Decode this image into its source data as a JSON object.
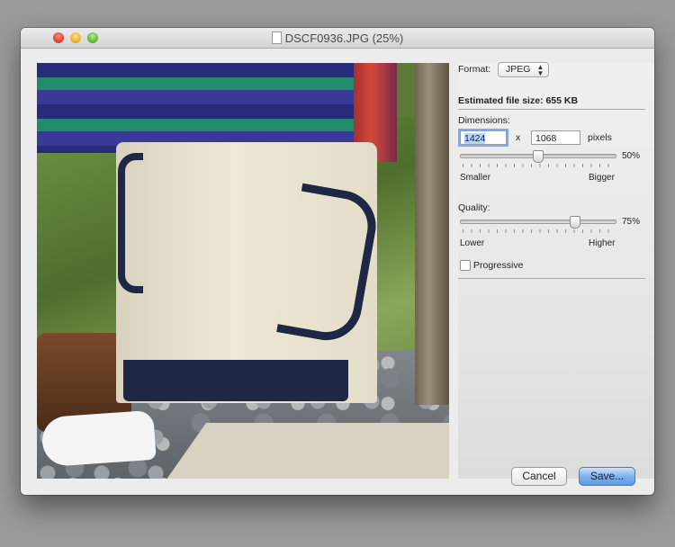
{
  "window": {
    "title": "DSCF0936.JPG (25%)"
  },
  "panel": {
    "format_label": "Format:",
    "format_value": "JPEG",
    "file_size_text": "Estimated file size: 655 KB",
    "dimensions_label": "Dimensions:",
    "width_value": "1424",
    "height_value": "1068",
    "times_symbol": "x",
    "units_label": "pixels",
    "size_percent": "50%",
    "size_min_label": "Smaller",
    "size_max_label": "Bigger",
    "size_slider_fraction": 0.5,
    "quality_label": "Quality:",
    "quality_percent": "75%",
    "quality_min_label": "Lower",
    "quality_max_label": "Higher",
    "quality_slider_fraction": 0.75,
    "progressive_label": "Progressive",
    "progressive_checked": false
  },
  "buttons": {
    "cancel_label": "Cancel",
    "save_label": "Save..."
  }
}
